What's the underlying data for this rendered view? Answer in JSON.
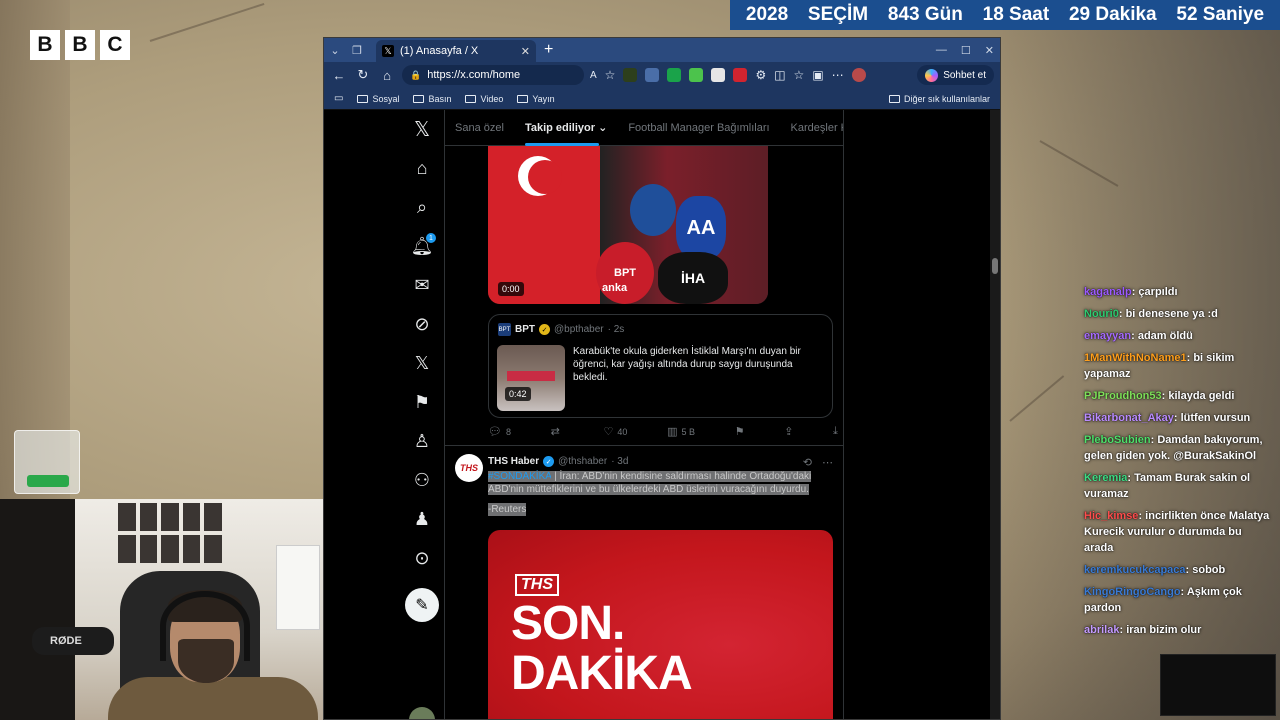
{
  "overlay": {
    "bbc_letters": [
      "B",
      "B",
      "C"
    ],
    "countdown": [
      "2028",
      "SEÇİM",
      "843 Gün",
      "18 Saat",
      "29 Dakika",
      "52 Saniye"
    ],
    "mic_brand": "RØDE"
  },
  "browser": {
    "tab_title": "(1) Anasayfa / X",
    "new_tab": "+",
    "url": "https://x.com/home",
    "copilot_label": "Sohbet et",
    "bookmarks": [
      "Sosyal",
      "Basın",
      "Video",
      "Yayın"
    ],
    "bookmarks_other": "Diğer sık kullanılanlar"
  },
  "x": {
    "notification_count": "1",
    "tabs": [
      "Sana özel",
      "Takip ediliyor",
      "Football Manager Bağımlıları",
      "Kardeşler Kıra"
    ],
    "post1": {
      "video_time": "0:00",
      "media_labels": [
        "AA",
        "BPT",
        "anka",
        "İHA"
      ],
      "quote": {
        "name": "BPT",
        "handle": "@bpthaber",
        "time": "· 2s",
        "text": "Karabük'te okula giderken İstiklal Marşı'nı duyan bir öğrenci, kar yağışı altında durup saygı duruşunda bekledi.",
        "video_time": "0:42"
      },
      "actions": {
        "replies": "8",
        "reposts": "",
        "likes": "40",
        "views": "5 B"
      }
    },
    "post2": {
      "avatar_text": "THS",
      "name": "THS Haber",
      "handle": "@thshaber",
      "time": "· 3d",
      "hashtag": "#SONDAKİKA",
      "text_pipe": " |",
      "text_line1": " İran: ABD'nin kendisine saldırması halinde Ortadoğu'daki",
      "text_line2": "ABD'nin müttefiklerini ve bu ülkelerdeki ABD üslerini vuracağını duyurdu.",
      "source": "-Reuters",
      "media_logo": "THS",
      "media_line1": "SON.",
      "media_line2": "DAKİKA"
    }
  },
  "chat": [
    {
      "user": "kaganalp",
      "color": "#9b59ff",
      "text": "çarpıldı"
    },
    {
      "user": "Nouri0",
      "color": "#2ecc71",
      "text": "bi denesene ya :d"
    },
    {
      "user": "emayyan",
      "color": "#a66bff",
      "text": "adam öldü"
    },
    {
      "user": "1ManWithNoName1",
      "color": "#ff9f1c",
      "text": "bi sikim yapamaz"
    },
    {
      "user": "PJProudhon53",
      "color": "#7fe05a",
      "text": "kilayda geldi"
    },
    {
      "user": "Bikarbonat_Akay",
      "color": "#b98bff",
      "text": "lütfen vursun"
    },
    {
      "user": "PleboSubien",
      "color": "#4ee06b",
      "text": "Damdan bakıyorum, gelen giden yok. @BurakSakinOl"
    },
    {
      "user": "Keremia",
      "color": "#3ddc84",
      "text": "Tamam Burak sakin ol vuramaz"
    },
    {
      "user": "Hic_kimse",
      "color": "#ff4d4d",
      "text": "incirlikten önce Malatya Kurecik vurulur o durumda bu arada"
    },
    {
      "user": "keremkucukcapaca",
      "color": "#3a7bd5",
      "text": "sobob"
    },
    {
      "user": "KingoRingoCango",
      "color": "#3a7bd5",
      "text": "Aşkım çok pardon"
    },
    {
      "user": "abrilak",
      "color": "#c49bff",
      "text": "iran bizim olur"
    }
  ],
  "colors": {
    "x_blue": "#1d9bf0",
    "browser_chrome": "#2b4a7e",
    "countdown_bg": "#1b4e8f",
    "ths_red": "#c3161c"
  }
}
